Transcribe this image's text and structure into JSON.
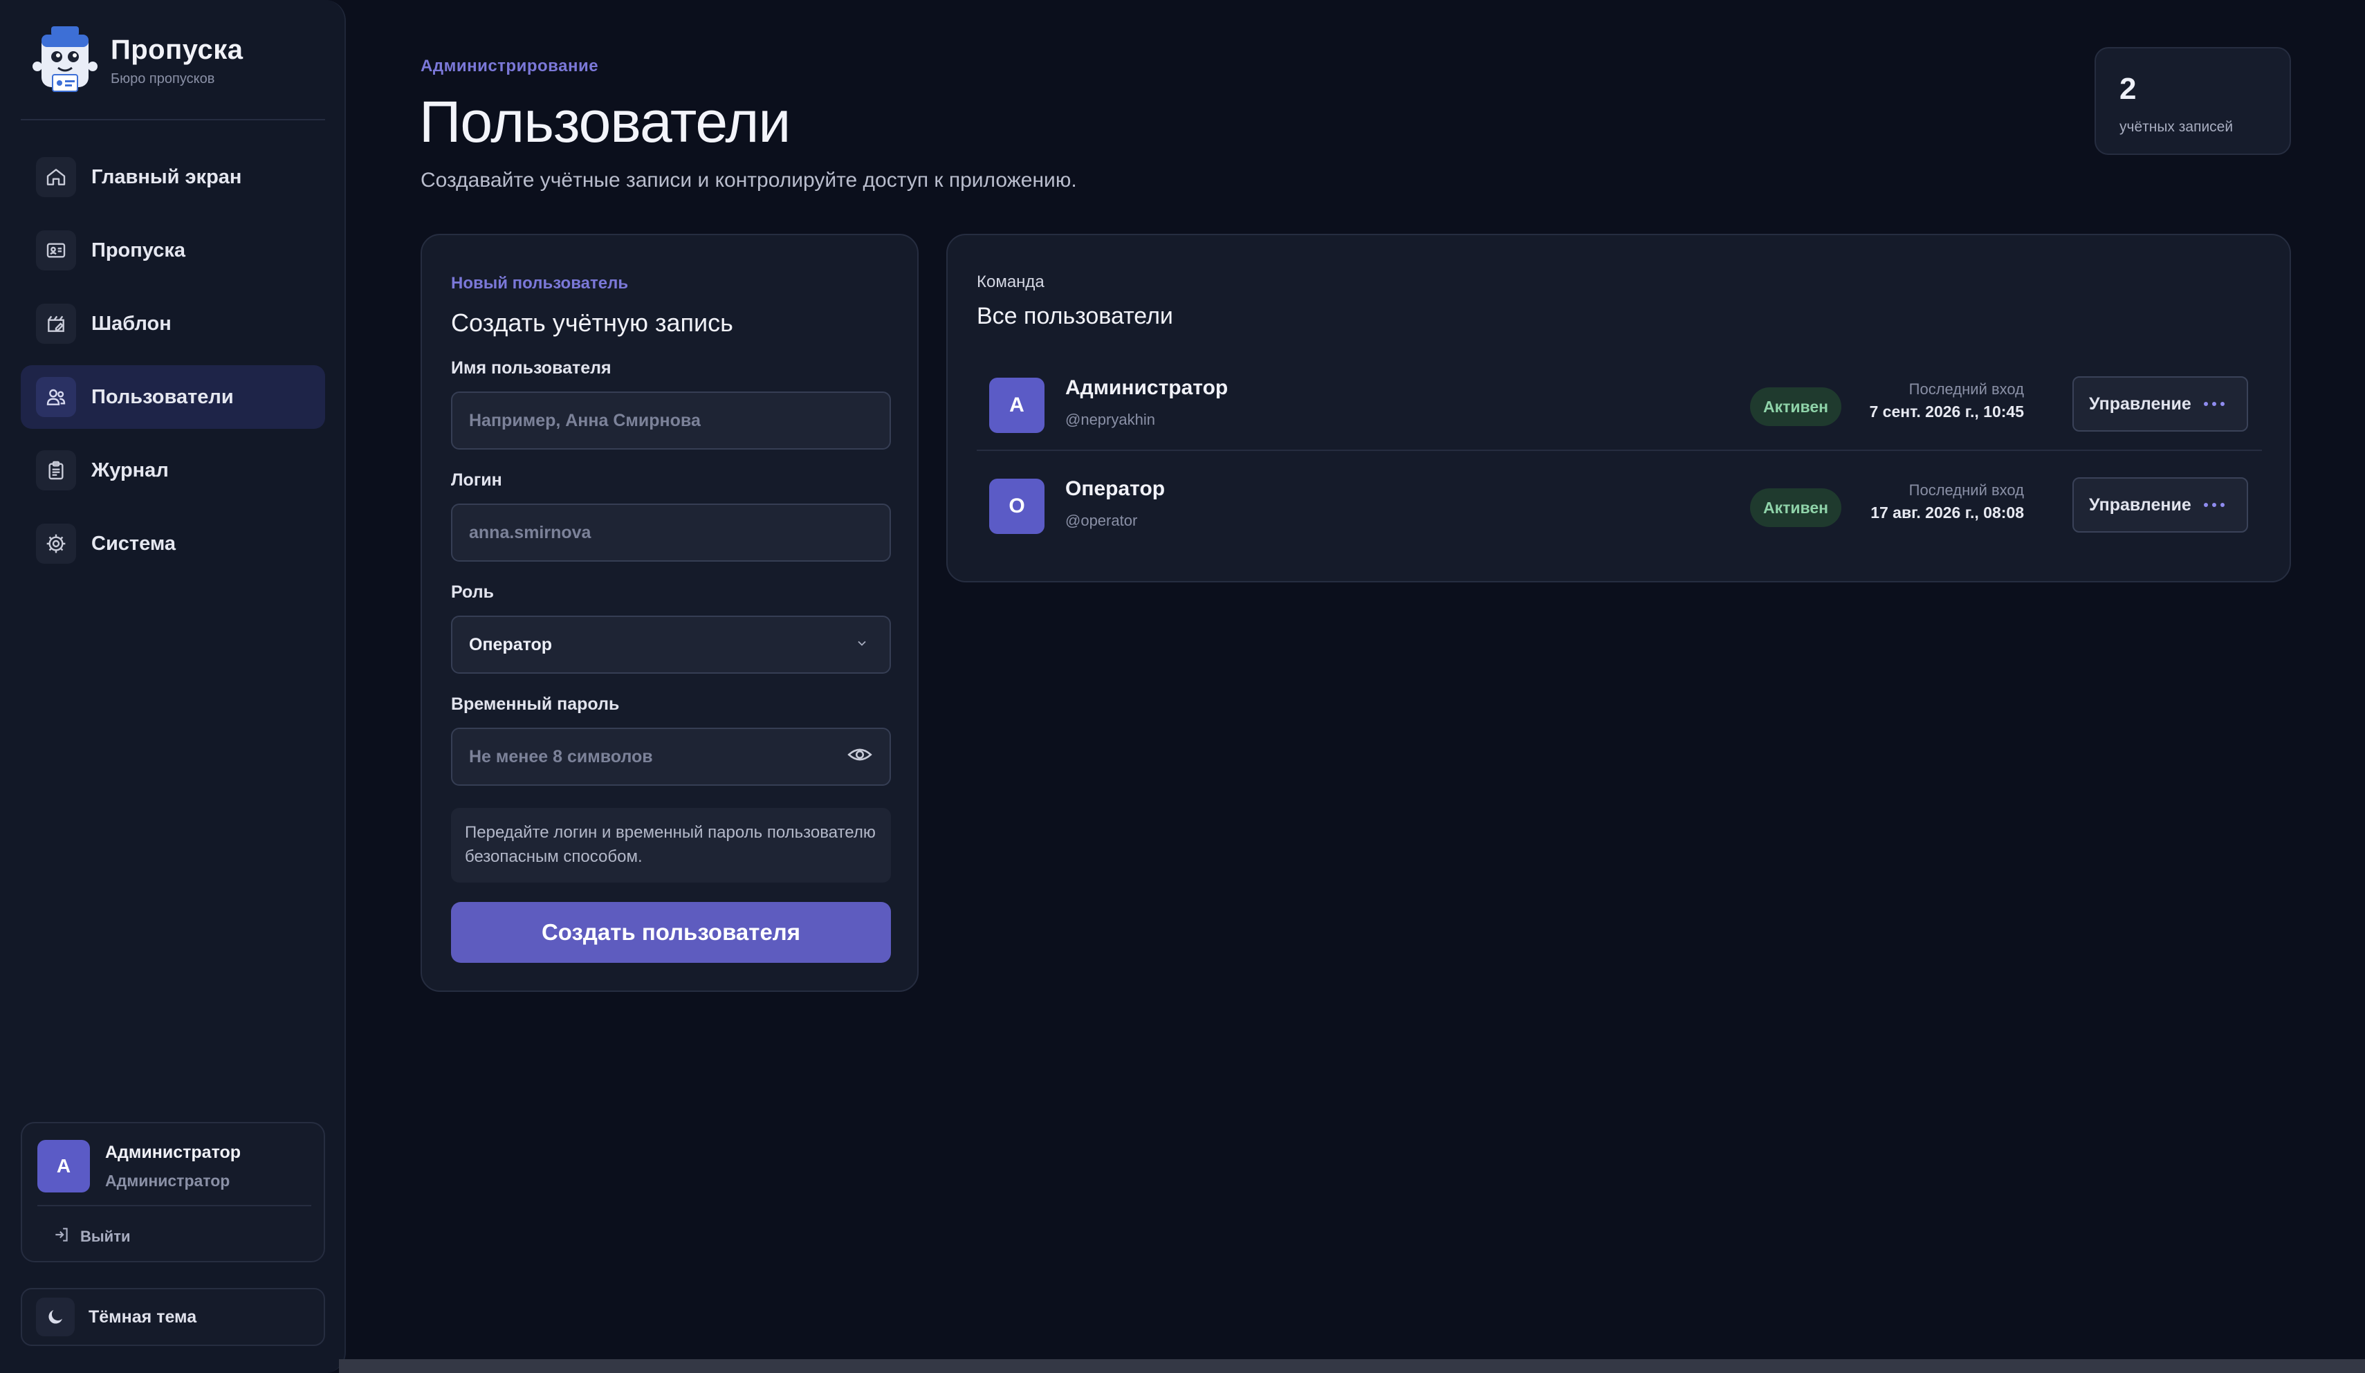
{
  "brand": {
    "title": "Пропуска",
    "subtitle": "Бюро пропусков"
  },
  "nav": [
    {
      "label": "Главный экран",
      "icon": "home-icon"
    },
    {
      "label": "Пропуска",
      "icon": "id-card-icon"
    },
    {
      "label": "Шаблон",
      "icon": "template-edit-icon"
    },
    {
      "label": "Пользователи",
      "icon": "users-icon",
      "active": true
    },
    {
      "label": "Журнал",
      "icon": "clipboard-icon"
    },
    {
      "label": "Система",
      "icon": "gear-icon"
    }
  ],
  "current_user": {
    "initial": "А",
    "name": "Администратор",
    "role": "Администратор",
    "logout_label": "Выйти"
  },
  "theme": {
    "label": "Тёмная тема"
  },
  "header": {
    "eyebrow": "Администрирование",
    "title": "Пользователи",
    "subtitle": "Создавайте учётные записи и контролируйте доступ к приложению."
  },
  "stats": {
    "count": "2",
    "label": "учётных записей"
  },
  "form": {
    "eyebrow": "Новый пользователь",
    "title": "Создать учётную запись",
    "name_label": "Имя пользователя",
    "name_placeholder": "Например, Анна Смирнова",
    "login_label": "Логин",
    "login_placeholder": "anna.smirnova",
    "role_label": "Роль",
    "role_value": "Оператор",
    "password_label": "Временный пароль",
    "password_placeholder": "Не менее 8 символов",
    "hint": "Передайте логин и временный пароль пользователю безопасным способом.",
    "submit_label": "Создать пользователя"
  },
  "team": {
    "eyebrow": "Команда",
    "title": "Все пользователи",
    "users": [
      {
        "initial": "А",
        "name": "Администратор",
        "handle": "@nepryakhin",
        "status": "Активен",
        "last_login_label": "Последний вход",
        "last_login": "7 сент. 2026 г., 10:45",
        "manage_label": "Управление"
      },
      {
        "initial": "О",
        "name": "Оператор",
        "handle": "@operator",
        "status": "Активен",
        "last_login_label": "Последний вход",
        "last_login": "17 авг. 2026 г., 08:08",
        "manage_label": "Управление"
      }
    ]
  },
  "colors": {
    "accent": "#5e5cbf",
    "background": "#0b0f1c",
    "panel": "#151b2a",
    "active_badge": "#1f3a2e"
  }
}
